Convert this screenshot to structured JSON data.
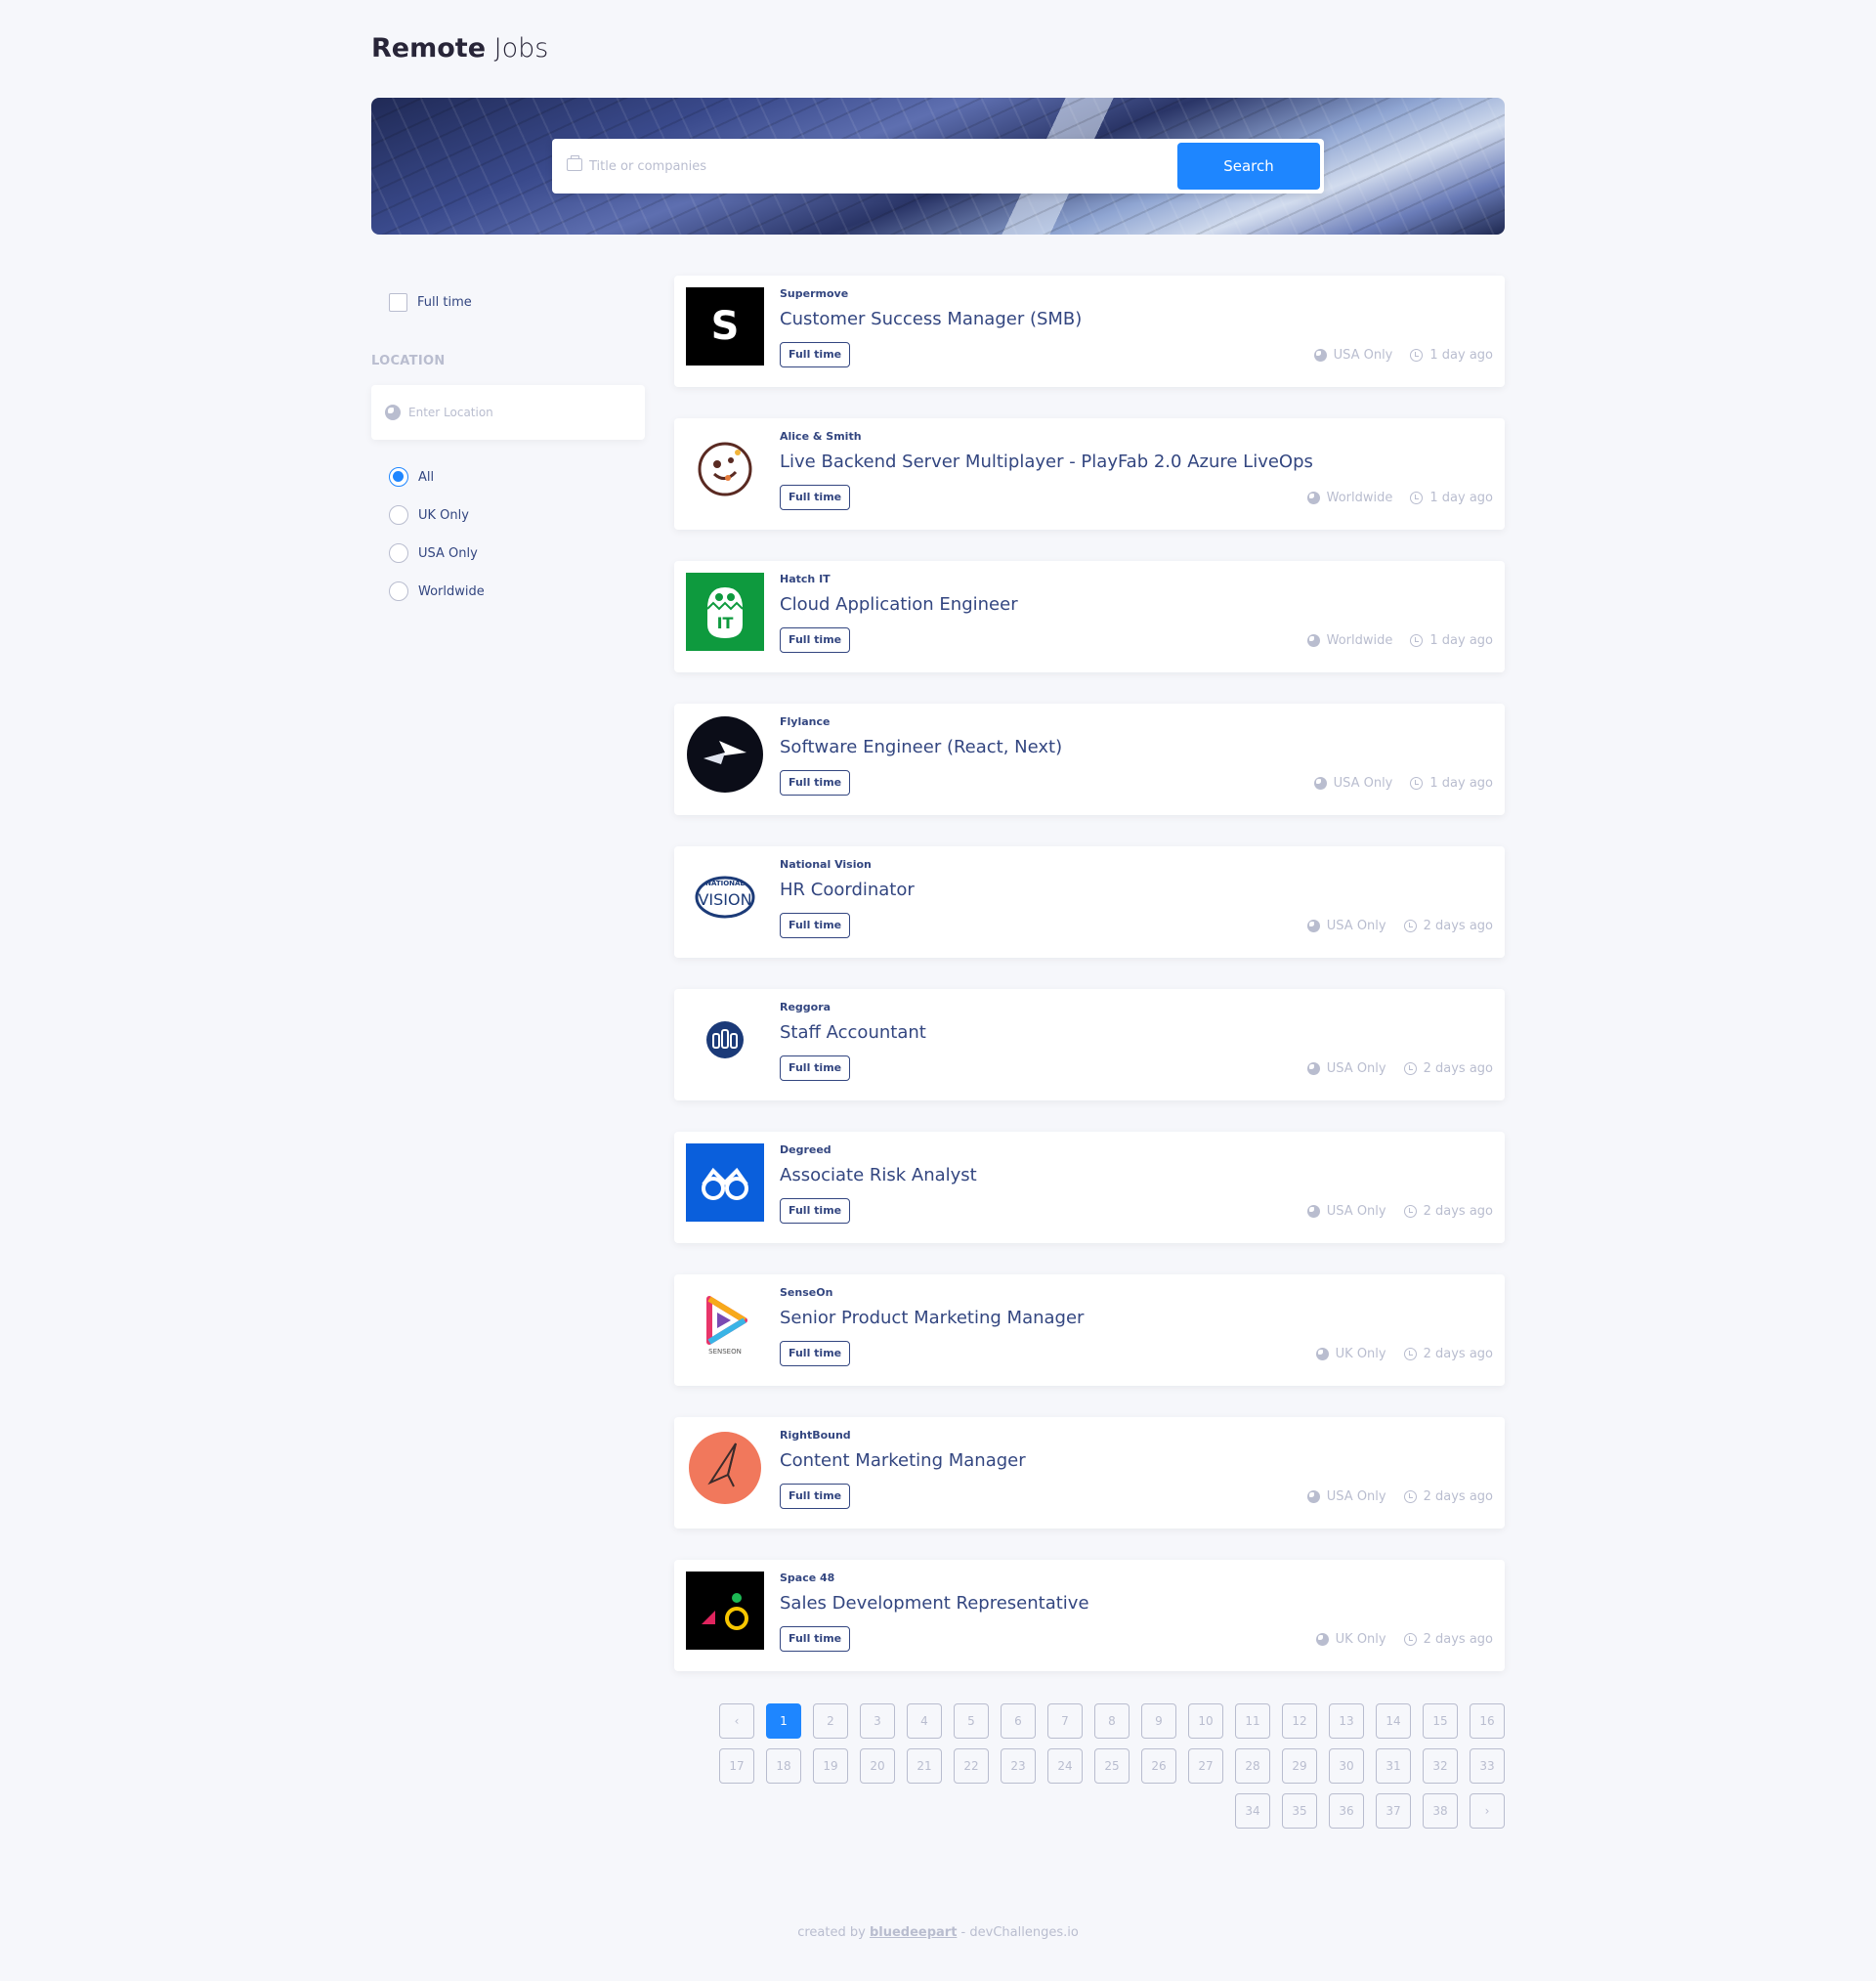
{
  "header": {
    "title_bold": "Remote",
    "title_light": "Jobs"
  },
  "search": {
    "placeholder": "Title or companies",
    "value": "",
    "button_label": "Search"
  },
  "filters": {
    "full_time_label": "Full time",
    "location_heading": "LOCATION",
    "location_placeholder": "Enter Location",
    "options": [
      {
        "label": "All",
        "selected": true
      },
      {
        "label": "UK Only",
        "selected": false
      },
      {
        "label": "USA Only",
        "selected": false
      },
      {
        "label": "Worldwide",
        "selected": false
      }
    ]
  },
  "jobs": [
    {
      "company": "Supermove",
      "title": "Customer Success Manager (SMB)",
      "type": "Full time",
      "location": "USA Only",
      "posted": "1 day ago",
      "logo": "supermove-logo"
    },
    {
      "company": "Alice & Smith",
      "title": "Live Backend Server Multiplayer - PlayFab 2.0 Azure LiveOps",
      "type": "Full time",
      "location": "Worldwide",
      "posted": "1 day ago",
      "logo": "alice-smith-logo"
    },
    {
      "company": "Hatch IT",
      "title": "Cloud Application Engineer",
      "type": "Full time",
      "location": "Worldwide",
      "posted": "1 day ago",
      "logo": "hatch-it-logo"
    },
    {
      "company": "Flylance",
      "title": "Software Engineer (React, Next)",
      "type": "Full time",
      "location": "USA Only",
      "posted": "1 day ago",
      "logo": "flylance-logo"
    },
    {
      "company": "National Vision",
      "title": "HR Coordinator",
      "type": "Full time",
      "location": "USA Only",
      "posted": "2 days ago",
      "logo": "national-vision-logo",
      "logo_text_small": "NATIONAL",
      "logo_text": "VISION"
    },
    {
      "company": "Reggora",
      "title": "Staff Accountant",
      "type": "Full time",
      "location": "USA Only",
      "posted": "2 days ago",
      "logo": "reggora-logo"
    },
    {
      "company": "Degreed",
      "title": "Associate Risk Analyst",
      "type": "Full time",
      "location": "USA Only",
      "posted": "2 days ago",
      "logo": "degreed-logo"
    },
    {
      "company": "SenseOn",
      "title": "Senior Product Marketing Manager",
      "type": "Full time",
      "location": "UK Only",
      "posted": "2 days ago",
      "logo": "senseon-logo",
      "logo_text": "SENSEON"
    },
    {
      "company": "RightBound",
      "title": "Content Marketing Manager",
      "type": "Full time",
      "location": "USA Only",
      "posted": "2 days ago",
      "logo": "rightbound-logo"
    },
    {
      "company": "Space 48",
      "title": "Sales Development Representative",
      "type": "Full time",
      "location": "UK Only",
      "posted": "2 days ago",
      "logo": "space48-logo"
    }
  ],
  "pagination": {
    "current": "1",
    "prev": "‹",
    "next": "›",
    "row1": [
      "1",
      "2",
      "3",
      "4",
      "5",
      "6",
      "7",
      "8",
      "9",
      "10",
      "11",
      "12",
      "13",
      "14",
      "15",
      "16"
    ],
    "row2": [
      "17",
      "18",
      "19",
      "20",
      "21",
      "22",
      "23",
      "24",
      "25",
      "26",
      "27",
      "28",
      "29",
      "30",
      "31",
      "32",
      "33"
    ],
    "row3": [
      "34",
      "35",
      "36",
      "37",
      "38"
    ]
  },
  "footer": {
    "prefix": "created by ",
    "author": "bluedeepart",
    "suffix": " - devChallenges.io"
  },
  "colors": {
    "accent": "#1e86ff",
    "text": "#334680",
    "muted": "#b9bdcf",
    "background": "#f6f7fb"
  }
}
